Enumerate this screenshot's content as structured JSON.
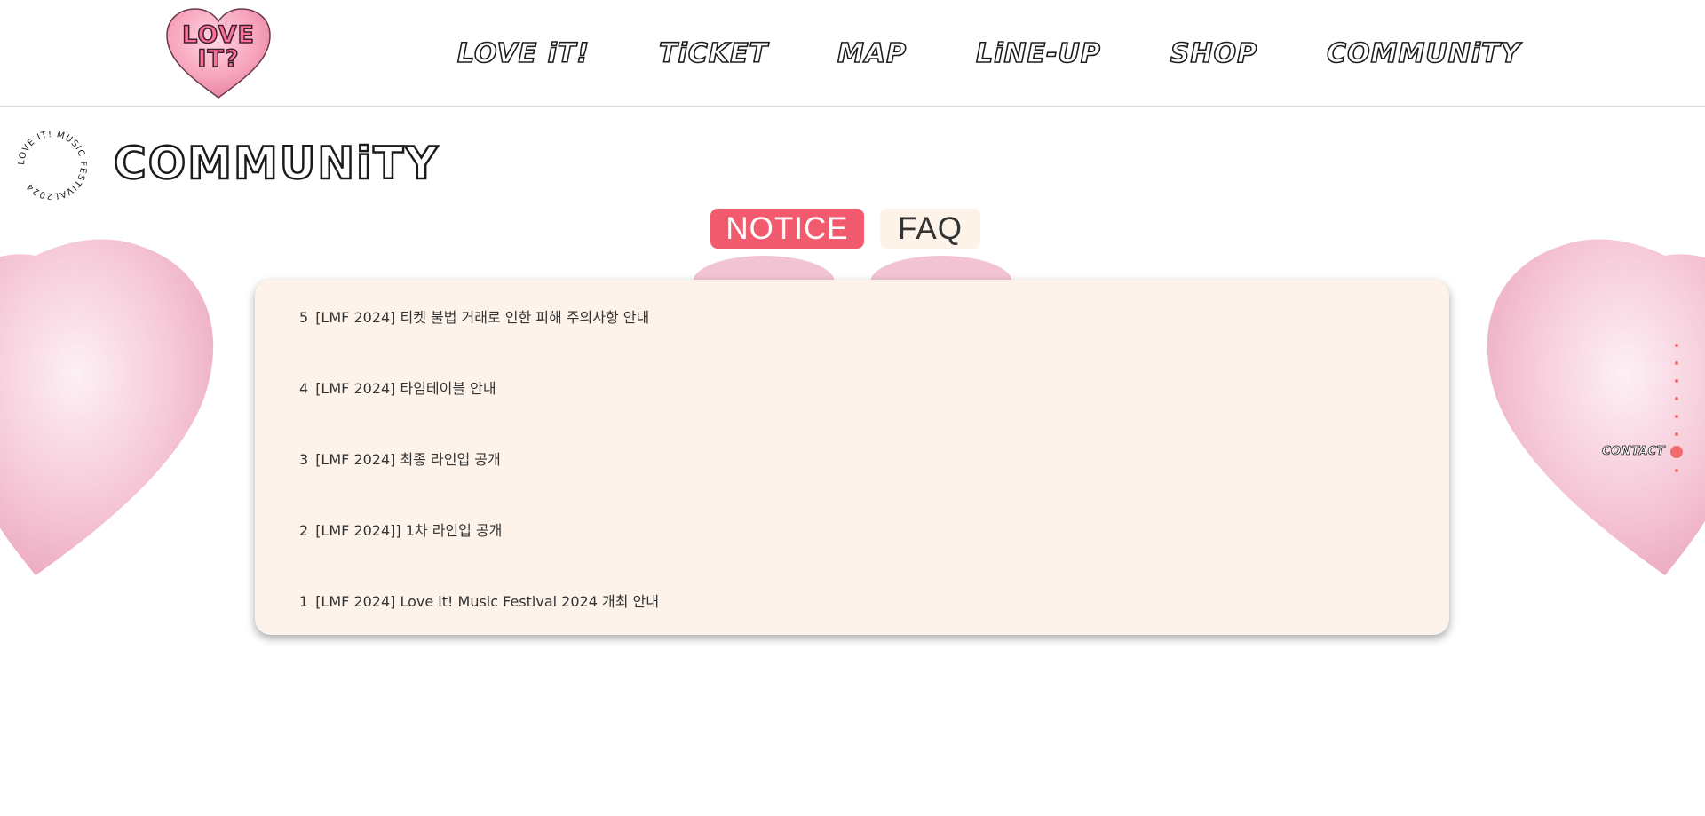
{
  "header": {
    "logo_text_line1": "LOVE",
    "logo_text_line2": "IT?",
    "nav": [
      {
        "label": "LOVE iT!"
      },
      {
        "label": "TiCKET"
      },
      {
        "label": "MAP"
      },
      {
        "label": "LiNE-UP"
      },
      {
        "label": "SHOP"
      },
      {
        "label": "COMMUNiTY"
      }
    ]
  },
  "badge": {
    "circle_text": "LOVE IT! MUSIC FESTIVAL2024 "
  },
  "page": {
    "title": "COMMUNiTY"
  },
  "tabs": {
    "notice_label": "NOTICE",
    "faq_label": "FAQ"
  },
  "notices": [
    {
      "num": "5",
      "title": "[LMF 2024] 티켓 불법 거래로 인한 피해 주의사항 안내"
    },
    {
      "num": "4",
      "title": "[LMF 2024] 타임테이블 안내"
    },
    {
      "num": "3",
      "title": "[LMF 2024] 최종 라인업 공개"
    },
    {
      "num": "2",
      "title": "[LMF 2024]] 1차 라인업 공개"
    },
    {
      "num": "1",
      "title": "[LMF 2024] Love it! Music Festival 2024 개최 안내"
    }
  ],
  "side_nav": {
    "active_label": "CONTACT"
  },
  "colors": {
    "accent": "#f25b6e",
    "panel_bg": "#fdf3ea",
    "heart_pink": "#f4b8cc",
    "dot": "#f26d6d"
  }
}
